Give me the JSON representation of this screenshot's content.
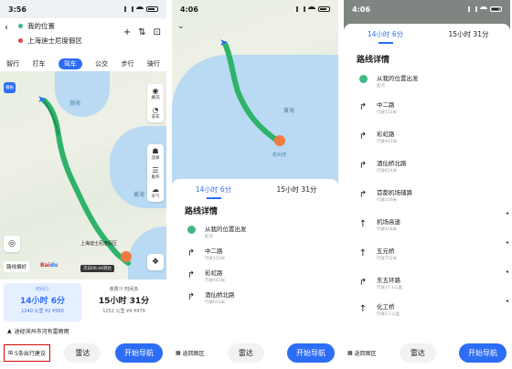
{
  "panel1": {
    "time": "3:56",
    "origin": "我的位置",
    "destination": "上海迪士尼度假区",
    "modes": [
      "打车",
      "驾车",
      "公交",
      "步行",
      "骑行"
    ],
    "active_mode": "驾车",
    "left_mode": "智行",
    "map_labels": {
      "bohai": "渤海",
      "yellow": "黄海",
      "east": "东海",
      "dest_label": "上海迪士尼度假区",
      "arrive": "次日06:44到达",
      "route_pref": "路线偏好",
      "qingliang": "清凉",
      "badge": "播报"
    },
    "controls": [
      "路况",
      "洗车",
      "违章",
      "服务",
      "天气"
    ],
    "plans": [
      {
        "tag": "时间少",
        "duration": "14小时 6分",
        "meta": "1240 公里 ¥2 ¥560"
      },
      {
        "tag": "收费少 时间多",
        "duration": "15小时 31分",
        "meta": "1252 公里 ¥4 ¥479"
      }
    ],
    "notice": "途经滨州市河有雷雨雨",
    "more_label": "5条出行建议",
    "radar_label": "雷达",
    "go_label": "开始导航"
  },
  "panel2": {
    "time": "4:06",
    "map_labels": {
      "yellow": "黄海",
      "hangzhou": "杭州湾",
      "bohai": "渤海"
    },
    "tabs": [
      "14小时 6分",
      "15小时 31分"
    ],
    "section": "路线详情",
    "steps": [
      {
        "icon": "start",
        "title": "从我的位置出发",
        "sub": "起点"
      },
      {
        "icon": "right",
        "title": "中二路",
        "sub": "行驶123米"
      },
      {
        "icon": "right",
        "title": "彩虹路",
        "sub": "行驶441米"
      },
      {
        "icon": "right",
        "title": "酒仙桥北路",
        "sub": "行驶654米"
      }
    ],
    "back_label": "返回图区",
    "radar_label": "雷达",
    "go_label": "开始导航"
  },
  "panel3": {
    "time": "4:06",
    "tabs": [
      "14小时 6分",
      "15小时 31分"
    ],
    "section": "路线详情",
    "steps": [
      {
        "icon": "start",
        "title": "从我的位置出发",
        "sub": "起点"
      },
      {
        "icon": "right",
        "title": "中二路",
        "sub": "行驶123米"
      },
      {
        "icon": "right",
        "title": "彩虹路",
        "sub": "行驶441米"
      },
      {
        "icon": "right",
        "title": "酒仙桥北路",
        "sub": "行驶654米"
      },
      {
        "icon": "right",
        "title": "首都机场辅路",
        "sub": "行驶256米"
      },
      {
        "icon": "straight",
        "title": "机场高速",
        "sub": "行驶416米"
      },
      {
        "icon": "straight",
        "title": "五元桥",
        "sub": "行驶752米"
      },
      {
        "icon": "right",
        "title": "东五环路",
        "sub": "行驶17.1公里"
      },
      {
        "icon": "straight",
        "title": "化工桥",
        "sub": "行驶1.1公里"
      }
    ],
    "back_label": "返回图区",
    "radar_label": "雷达",
    "go_label": "开始导航"
  },
  "colors": {
    "accent": "#2d6df6",
    "route": "#2fb26a",
    "highlight": "#d10b0b"
  }
}
